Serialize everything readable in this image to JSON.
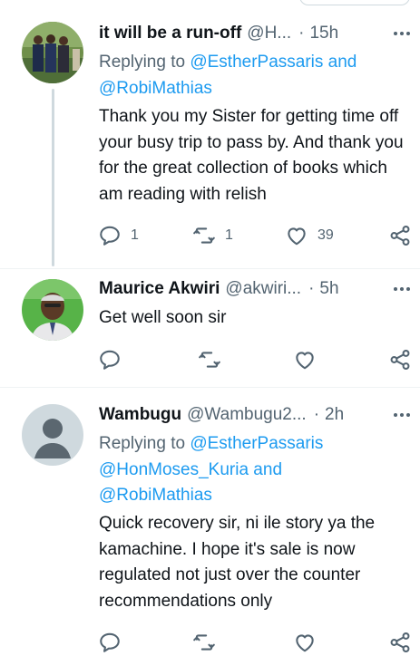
{
  "tweets": [
    {
      "name": "it will be a run-off",
      "handle": "@H...",
      "dot": "·",
      "time": "15h",
      "replying_prefix": "Replying to",
      "replying_mentions_1": "@EstherPassaris and",
      "replying_mentions_2": "@RobiMathias",
      "text": "Thank you my Sister for getting time off your busy trip to pass by. And thank you for the great collection of books which am reading with relish",
      "reply_count": "1",
      "retweet_count": "1",
      "like_count": "39"
    },
    {
      "name": "Maurice Akwiri",
      "handle": "@akwiri...",
      "dot": "·",
      "time": "5h",
      "text": "Get well soon sir",
      "reply_count": "",
      "retweet_count": "",
      "like_count": ""
    },
    {
      "name": "Wambugu",
      "handle": "@Wambugu2...",
      "dot": "·",
      "time": "2h",
      "replying_prefix": "Replying to",
      "replying_mentions_1": "@EstherPassaris",
      "replying_mentions_2": "@HonMoses_Kuria and",
      "replying_mentions_3": "@RobiMathias",
      "text": "Quick recovery sir, ni ile story ya the kamachine. I hope it's sale is now regulated not just over the counter recommendations only"
    }
  ],
  "icons": {
    "reply": "reply-icon",
    "retweet": "retweet-icon",
    "like": "heart-icon",
    "share": "share-icon",
    "more": "more-icon"
  },
  "colors": {
    "accent": "#1d9bf0",
    "secondary_text": "#536471",
    "divider": "#eff3f4"
  }
}
